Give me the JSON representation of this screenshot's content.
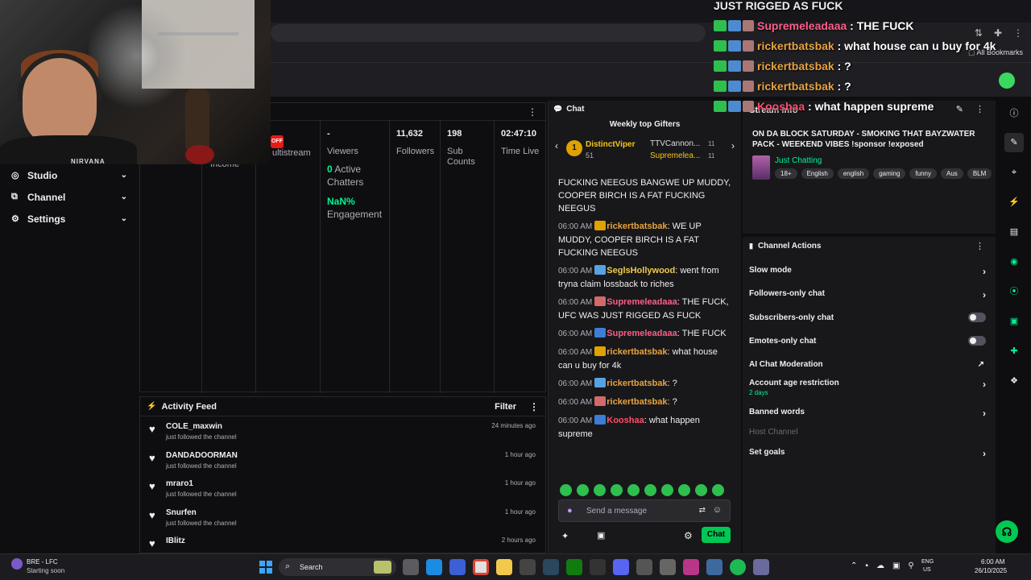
{
  "browser": {
    "bookmarks_label": "All Bookmarks"
  },
  "overlay": {
    "top_line": "JUST RIGGED AS FUCK",
    "lines": [
      {
        "user": "Supremeleadaaa",
        "text": "THE FUCK",
        "color": "#ff5c8a"
      },
      {
        "user": "rickertbatsbak",
        "text": "what house can u buy for 4k",
        "color": "#e8a33d"
      },
      {
        "user": "rickertbatsbak",
        "text": "?",
        "color": "#e8a33d"
      },
      {
        "user": "rickertbatsbak",
        "text": "?",
        "color": "#e8a33d"
      },
      {
        "user": "Kooshaa",
        "text": "what happen supreme",
        "color": "#ff4d6d"
      }
    ]
  },
  "webcam": {
    "shirt_text": "NIRVANA"
  },
  "nav": {
    "items": [
      {
        "label": "Studio",
        "icon": "studio-icon"
      },
      {
        "label": "Channel",
        "icon": "channel-icon"
      },
      {
        "label": "Settings",
        "icon": "gear-icon"
      }
    ]
  },
  "stats": {
    "live_badge": "OFF",
    "multistream": "ultistream",
    "income": "Income",
    "viewers_value": "-",
    "viewers_label": "Viewers",
    "active_chatters_value": "0",
    "active_chatters_label": "Active Chatters",
    "engagement_value": "NaN%",
    "engagement_label": "Engagement",
    "followers_value": "11,632",
    "followers_label": "Followers",
    "subs_value": "198",
    "subs_label": "Sub Counts",
    "time_value": "02:47:10",
    "time_label": "Time Live"
  },
  "activity": {
    "title": "Activity Feed",
    "filter": "Filter",
    "rows": [
      {
        "name": "COLE_maxwin",
        "desc": "just followed the channel",
        "time": "24 minutes ago"
      },
      {
        "name": "DANDADOORMAN",
        "desc": "just followed the channel",
        "time": "1 hour ago"
      },
      {
        "name": "mraro1",
        "desc": "just followed the channel",
        "time": "1 hour ago"
      },
      {
        "name": "Snurfen",
        "desc": "just followed the channel",
        "time": "1 hour ago"
      },
      {
        "name": "IBlitz",
        "desc": "",
        "time": "2 hours ago"
      }
    ]
  },
  "chat": {
    "title": "Chat",
    "gifters_title": "Weekly top Gifters",
    "gifter1": {
      "rank": "1",
      "name": "DistinctViper",
      "count": "51"
    },
    "gifter2": {
      "name": "TTVCannon...",
      "count": "11"
    },
    "gifter3": {
      "name": "Supremelea...",
      "count": "11"
    },
    "messages": [
      {
        "time": "",
        "user": "",
        "text": "FUCKING NEEGUS BANGWE UP MUDDY, COOPER BIRCH IS A FAT FUCKING NEEGUS",
        "ucls": ""
      },
      {
        "time": "06:00 AM",
        "user": "rickertbatsbak",
        "text": "WE UP MUDDY, COOPER BIRCH IS A FAT FUCKING NEEGUS",
        "ucls": "u-ric"
      },
      {
        "time": "06:00 AM",
        "user": "SeglsHollywood",
        "text": "went from tryna claim lossback to riches",
        "ucls": "u-seg"
      },
      {
        "time": "06:00 AM",
        "user": "Supremeleadaaa",
        "text": "THE FUCK, UFC WAS JUST RIGGED AS FUCK",
        "ucls": "u-sup"
      },
      {
        "time": "06:00 AM",
        "user": "Supremeleadaaa",
        "text": "THE FUCK",
        "ucls": "u-sup"
      },
      {
        "time": "06:00 AM",
        "user": "rickertbatsbak",
        "text": "what house can u buy for 4k",
        "ucls": "u-ric"
      },
      {
        "time": "06:00 AM",
        "user": "rickertbatsbak",
        "text": "?",
        "ucls": "u-ric"
      },
      {
        "time": "06:00 AM",
        "user": "rickertbatsbak",
        "text": "?",
        "ucls": "u-ric"
      },
      {
        "time": "06:00 AM",
        "user": "Kooshaa",
        "text": "what happen supreme",
        "ucls": "u-koo"
      }
    ],
    "placeholder": "Send a message",
    "chat_button": "Chat"
  },
  "stream_info": {
    "header": "Stream Info",
    "title": "ON DA BLOCK SATURDAY - SMOKING THAT BAYZWATER PACK - WEEKEND VIBES !sponsor !exposed",
    "category": "Just Chatting",
    "tags": [
      "18+",
      "English",
      "english",
      "gaming",
      "funny",
      "Aus",
      "BLM"
    ]
  },
  "channel_actions": {
    "title": "Channel Actions",
    "rows": [
      {
        "label": "Slow mode",
        "kind": "arrow",
        "sub": ""
      },
      {
        "label": "Followers-only chat",
        "kind": "arrow",
        "sub": ""
      },
      {
        "label": "Subscribers-only chat",
        "kind": "toggle",
        "sub": ""
      },
      {
        "label": "Emotes-only chat",
        "kind": "toggle",
        "sub": ""
      },
      {
        "label": "AI Chat Moderation",
        "kind": "ext",
        "sub": ""
      },
      {
        "label": "Account age restriction",
        "kind": "arrow",
        "sub": "2 days"
      },
      {
        "label": "Banned words",
        "kind": "arrow",
        "sub": ""
      },
      {
        "label": "Host Channel",
        "kind": "disabled",
        "sub": ""
      },
      {
        "label": "Set goals",
        "kind": "arrow",
        "sub": ""
      }
    ]
  },
  "taskbar": {
    "status_line1": "BRE - LFC",
    "status_line2": "Starting soon",
    "search": "Search",
    "lang1": "ENG",
    "lang2": "US",
    "time": "6:00 AM",
    "date": "26/10/2025"
  }
}
